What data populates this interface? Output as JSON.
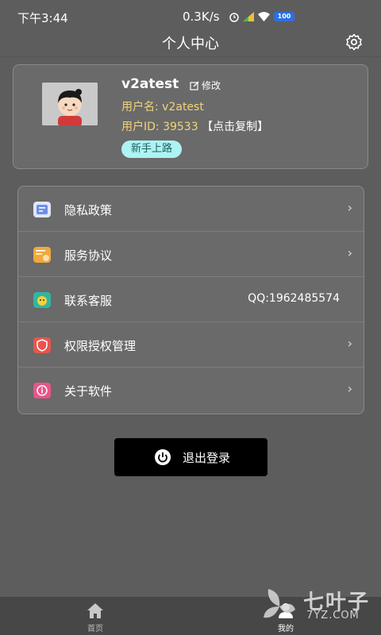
{
  "status_bar": {
    "time": "下午3:44",
    "network_speed": "0.3K/s",
    "battery": "100"
  },
  "header": {
    "title": "个人中心"
  },
  "profile": {
    "display_name": "v2atest",
    "edit_label": "修改",
    "username_line": "用户名: v2atest",
    "userid_prefix": "用户ID: 39533",
    "copy_label": "【点击复制】",
    "badge": "新手上路"
  },
  "menu": {
    "items": [
      {
        "label": "隐私政策",
        "icon": "privacy-icon",
        "color": "#6d8ee8"
      },
      {
        "label": "服务协议",
        "icon": "agreement-icon",
        "color": "#f2a93b"
      },
      {
        "label": "联系客服",
        "icon": "service-icon",
        "color": "#33b5a0",
        "value": "QQ:1962485574"
      },
      {
        "label": "权限授权管理",
        "icon": "permission-icon",
        "color": "#e8554f"
      },
      {
        "label": "关于软件",
        "icon": "about-icon",
        "color": "#e8558a"
      }
    ]
  },
  "logout": {
    "label": "退出登录"
  },
  "bottom_nav": {
    "home": "首页",
    "me": "我的"
  },
  "watermark": {
    "cn": "七叶子",
    "en": "7YZ.COM"
  }
}
